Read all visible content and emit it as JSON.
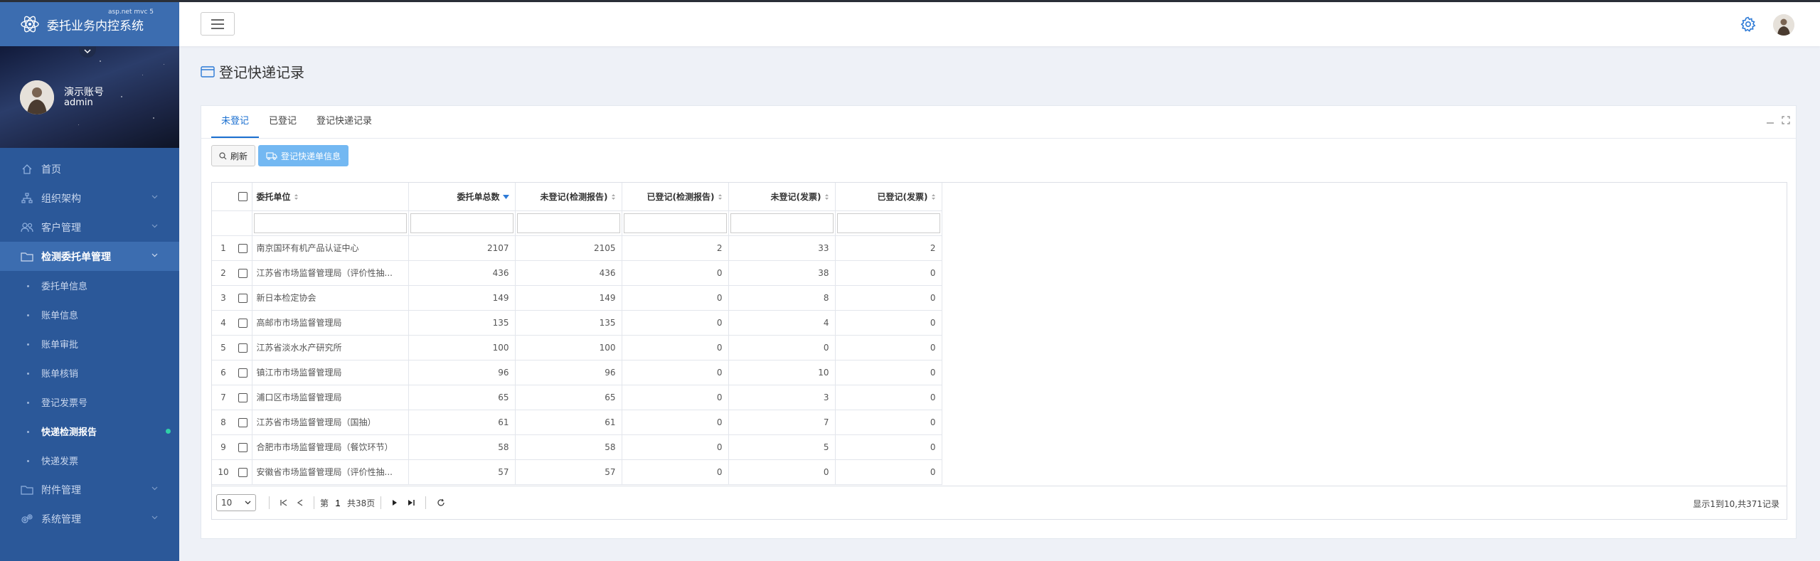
{
  "app": {
    "title": "委托业务内控系统",
    "version": "asp.net mvc 5"
  },
  "user": {
    "name": "演示账号",
    "role": "admin"
  },
  "menu": [
    {
      "label": "首页"
    },
    {
      "label": "组织架构"
    },
    {
      "label": "客户管理"
    },
    {
      "label": "检测委托单管理"
    },
    {
      "label": "附件管理"
    },
    {
      "label": "系统管理"
    }
  ],
  "submenu": [
    {
      "label": "委托单信息"
    },
    {
      "label": "账单信息"
    },
    {
      "label": "账单审批"
    },
    {
      "label": "账单核销"
    },
    {
      "label": "登记发票号"
    },
    {
      "label": "快递检测报告"
    },
    {
      "label": "快递发票"
    }
  ],
  "page": {
    "title": "登记快递记录"
  },
  "tabs": [
    {
      "label": "未登记"
    },
    {
      "label": "已登记"
    },
    {
      "label": "登记快递记录"
    }
  ],
  "toolbar": {
    "refresh": "刷新",
    "register": "登记快递单信息"
  },
  "table": {
    "columns": [
      "委托单位",
      "委托单总数",
      "未登记(检测报告)",
      "已登记(检测报告)",
      "未登记(发票)",
      "已登记(发票)"
    ],
    "rows": [
      {
        "n": "1",
        "unit": "南京国环有机产品认证中心",
        "total": "2107",
        "unreg_report": "2105",
        "reg_report": "2",
        "unreg_inv": "33",
        "reg_inv": "2"
      },
      {
        "n": "2",
        "unit": "江苏省市场监督管理局（评价性抽...",
        "total": "436",
        "unreg_report": "436",
        "reg_report": "0",
        "unreg_inv": "38",
        "reg_inv": "0"
      },
      {
        "n": "3",
        "unit": "新日本检定协会",
        "total": "149",
        "unreg_report": "149",
        "reg_report": "0",
        "unreg_inv": "8",
        "reg_inv": "0"
      },
      {
        "n": "4",
        "unit": "高邮市市场监督管理局",
        "total": "135",
        "unreg_report": "135",
        "reg_report": "0",
        "unreg_inv": "4",
        "reg_inv": "0"
      },
      {
        "n": "5",
        "unit": "江苏省淡水水产研究所",
        "total": "100",
        "unreg_report": "100",
        "reg_report": "0",
        "unreg_inv": "0",
        "reg_inv": "0"
      },
      {
        "n": "6",
        "unit": "镇江市市场监督管理局",
        "total": "96",
        "unreg_report": "96",
        "reg_report": "0",
        "unreg_inv": "10",
        "reg_inv": "0"
      },
      {
        "n": "7",
        "unit": "浦口区市场监督管理局",
        "total": "65",
        "unreg_report": "65",
        "reg_report": "0",
        "unreg_inv": "3",
        "reg_inv": "0"
      },
      {
        "n": "8",
        "unit": "江苏省市场监督管理局（国抽）",
        "total": "61",
        "unreg_report": "61",
        "reg_report": "0",
        "unreg_inv": "7",
        "reg_inv": "0"
      },
      {
        "n": "9",
        "unit": "合肥市市场监督管理局（餐饮环节）",
        "total": "58",
        "unreg_report": "58",
        "reg_report": "0",
        "unreg_inv": "5",
        "reg_inv": "0"
      },
      {
        "n": "10",
        "unit": "安徽省市场监督管理局（评价性抽...",
        "total": "57",
        "unreg_report": "57",
        "reg_report": "0",
        "unreg_inv": "0",
        "reg_inv": "0"
      }
    ]
  },
  "pager": {
    "page_size": "10",
    "page_prefix": "第",
    "page": "1",
    "page_total": "共38页",
    "info": "显示1到10,共371记录"
  },
  "colors": {
    "sidebar": "#2b5899",
    "accent": "#1a6fd0",
    "primary_button": "#73b8f2"
  }
}
